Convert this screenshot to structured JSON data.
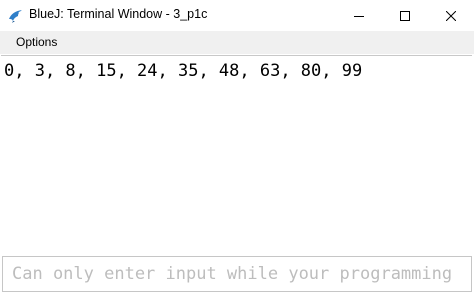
{
  "window": {
    "title": "BlueJ: Terminal Window - 3_p1c"
  },
  "icons": {
    "app": "bluej-bird-icon",
    "minimize": "minimize-icon",
    "maximize": "maximize-icon",
    "close": "close-icon"
  },
  "menubar": {
    "items": [
      {
        "label": "Options"
      }
    ]
  },
  "output": {
    "text": "0, 3, 8, 15, 24, 35, 48, 63, 80, 99"
  },
  "input": {
    "value": "",
    "placeholder": "Can only enter input while your programming"
  },
  "colors": {
    "menubar_bg": "#f0f0f0",
    "placeholder": "#bdbdbd",
    "icon_blue": "#2f7fc9"
  }
}
